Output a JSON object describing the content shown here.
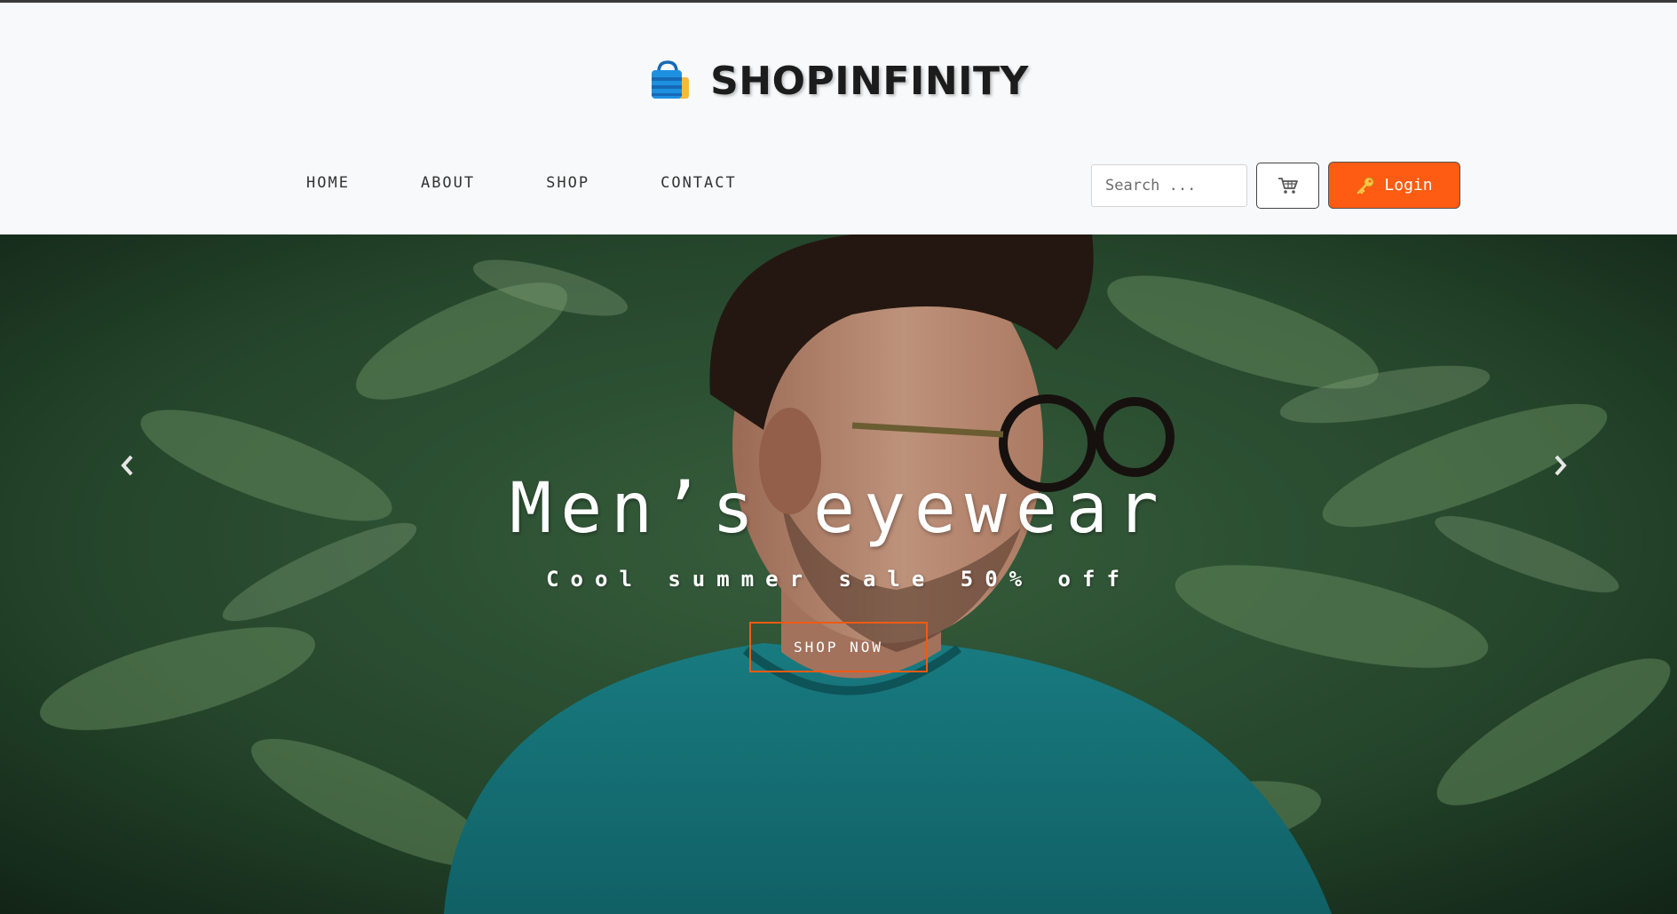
{
  "brand": {
    "name": "SHOPINFINITY",
    "logo_icon": "shopping-bag-icon"
  },
  "nav": {
    "items": [
      "HOME",
      "ABOUT",
      "SHOP",
      "CONTACT"
    ]
  },
  "search": {
    "placeholder": "Search ..."
  },
  "cart": {
    "icon": "shopping-cart-icon"
  },
  "login": {
    "label": "Login",
    "icon": "key-icon",
    "color": "#fd5c12"
  },
  "hero": {
    "title": "Men’s eyewear",
    "subtitle": "Cool summer sale 50% off",
    "cta_label": "SHOP NOW",
    "cta_border_color": "#f05a14",
    "prev_icon": "chevron-left-icon",
    "next_icon": "chevron-right-icon"
  }
}
